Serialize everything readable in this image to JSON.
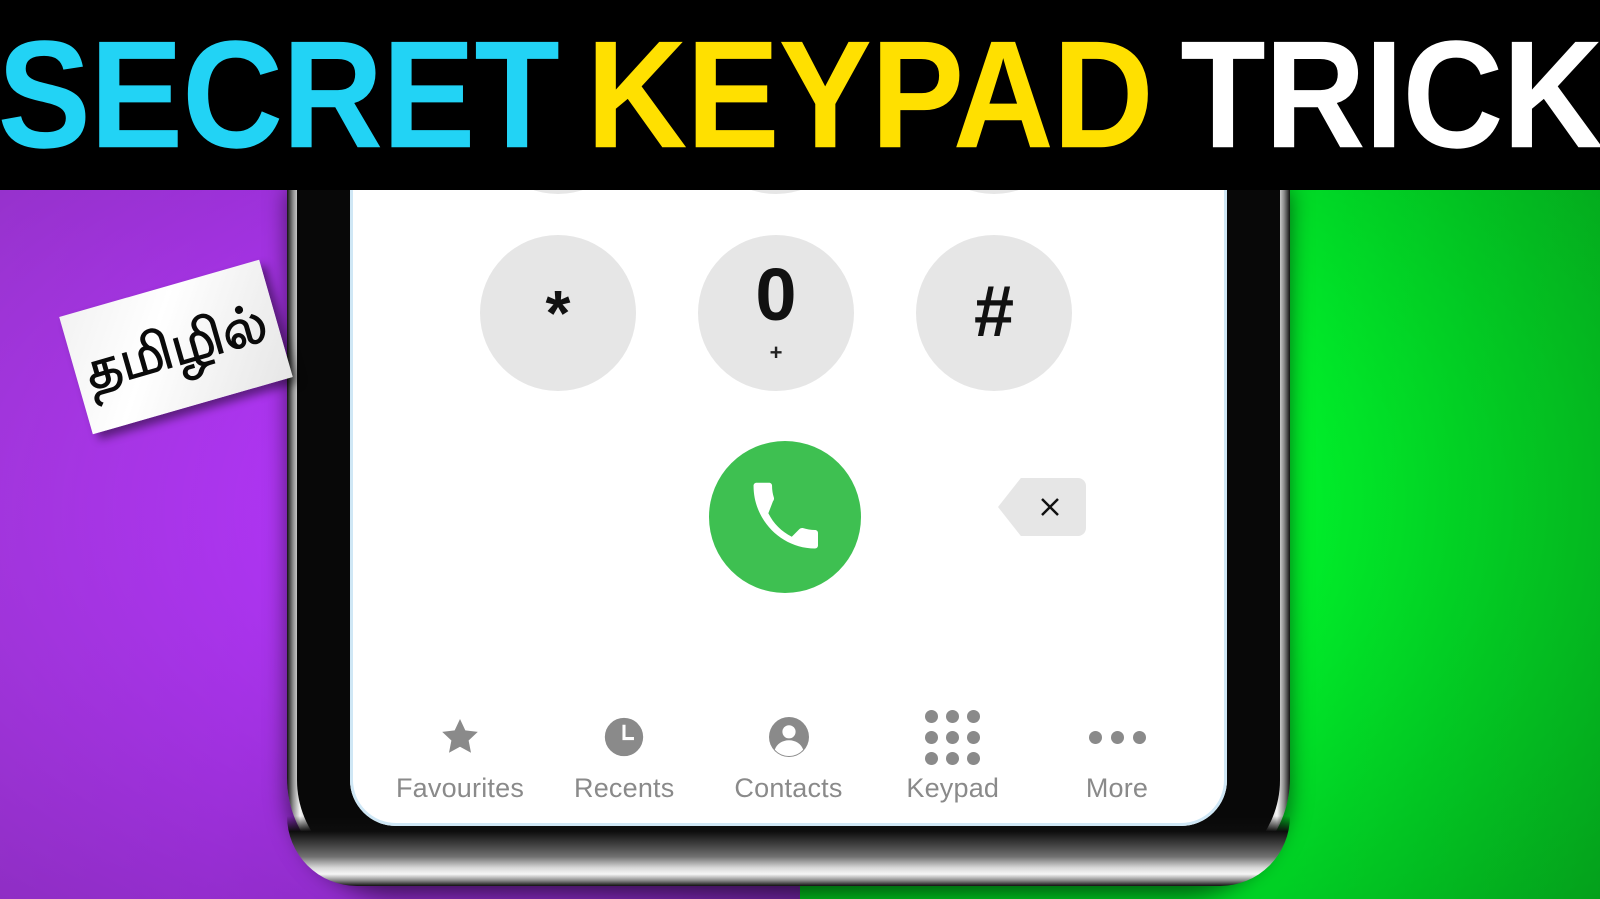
{
  "banner": {
    "word1": "SECRET",
    "word2": "KEYPAD",
    "word3": "TRICK",
    "color1": "#22d3f5",
    "color2": "#ffe000",
    "color3": "#ffffff",
    "background": "#000000"
  },
  "sticker": {
    "text": "தமிழில்"
  },
  "background": {
    "left_color": "#ae35f2",
    "right_color": "#00e825"
  },
  "phone": {
    "screen_background": "#ffffff",
    "bezel_color": "#080808"
  },
  "dialer": {
    "keys": [
      {
        "main": "*",
        "sub": ""
      },
      {
        "main": "0",
        "sub": "+"
      },
      {
        "main": "#",
        "sub": ""
      }
    ],
    "key_background": "#e6e6e6",
    "call_button": {
      "icon": "phone-handset-icon",
      "color": "#3ec051"
    },
    "backspace_button": {
      "icon": "close-x-icon",
      "color": "#e6e6e6"
    }
  },
  "tabbar": {
    "active": "Keypad",
    "label_color": "#8a8a8a",
    "items": [
      {
        "label": "Favourites",
        "icon": "star-icon"
      },
      {
        "label": "Recents",
        "icon": "clock-icon"
      },
      {
        "label": "Contacts",
        "icon": "person-icon"
      },
      {
        "label": "Keypad",
        "icon": "dial-grid-icon"
      },
      {
        "label": "More",
        "icon": "ellipsis-icon"
      }
    ]
  }
}
